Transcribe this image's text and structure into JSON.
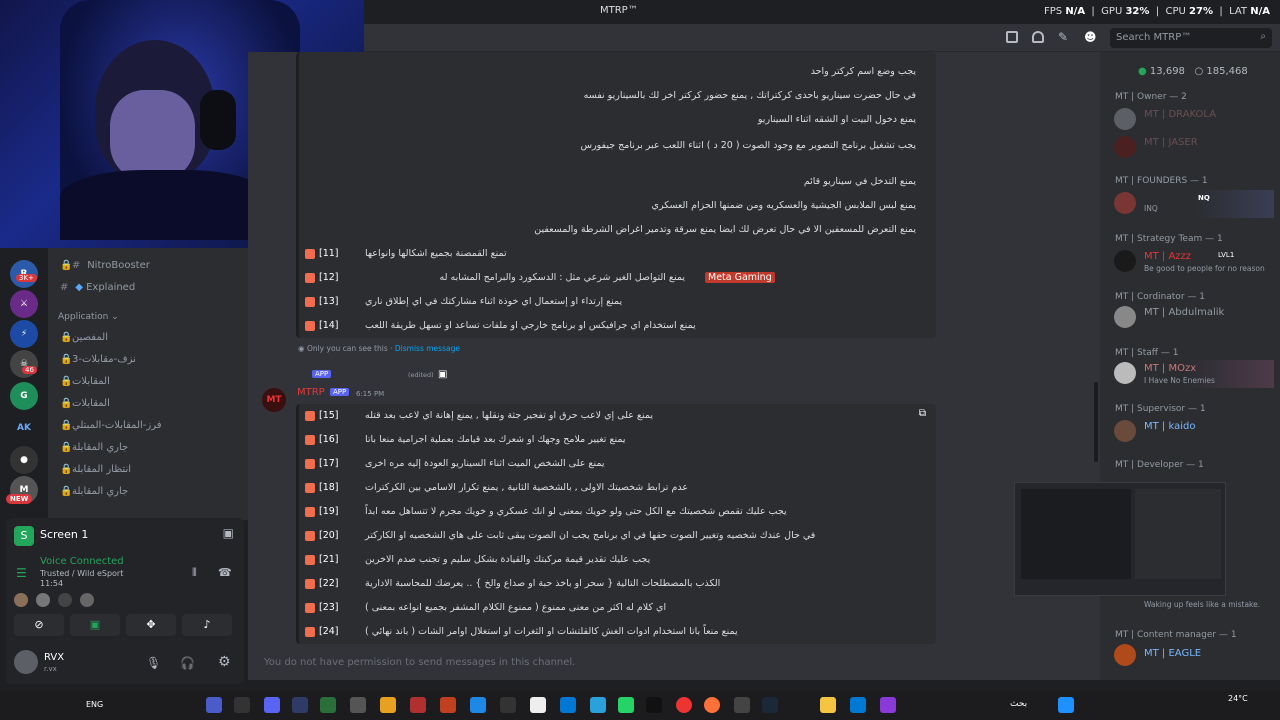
{
  "topbar": {
    "app_title": "MTRP™",
    "fps_label": "FPS",
    "fps_value": "N/A",
    "gpu_label": "GPU",
    "gpu_value": "32%",
    "cpu_label": "CPU",
    "cpu_value": "27%",
    "lat_label": "LAT",
    "lat_value": "N/A"
  },
  "search": {
    "placeholder": "Search MTRP™"
  },
  "rail": {
    "badges": [
      "3K+",
      "46",
      "NEW"
    ]
  },
  "sidebar": {
    "channels": [
      {
        "label": "NitroBooster"
      },
      {
        "label": "Explained"
      }
    ],
    "category": "Application",
    "app_channels": [
      {
        "label": "المفصين"
      },
      {
        "label": "3-نزف-مقابلات"
      },
      {
        "label": "المقابلات"
      },
      {
        "label": "المقابلات"
      },
      {
        "label": "فرز-المقابلات-المبتلي"
      },
      {
        "label": "جاري المقابلة"
      },
      {
        "label": "انتظار المقابلة"
      },
      {
        "label": "جاري المقابلة"
      }
    ]
  },
  "screen_share": {
    "title": "Screen 1",
    "voice_status": "Voice Connected",
    "voice_channel": "Trusted / Wild eSport",
    "time": "11:54"
  },
  "user": {
    "name": "RVX",
    "tag": "r.vx"
  },
  "messages": {
    "first_rules": [
      {
        "num": "",
        "text": "يجب وضع اسم كركتر واحد"
      },
      {
        "num": "",
        "text": "في حال حضرت سيناريو باحدى كركتراتك , يمنع حضور كركتر اخر لك بالسيناريو نفسه"
      },
      {
        "num": "",
        "text": "يمنع دخول البيت او الشقه اثناء السيناريو"
      },
      {
        "num": "",
        "text": "يجب تشغيل برنامج التصوير مع وجود الصوت ( 20 د ) اثناء اللعب عبر برنامج جيفورس"
      },
      {
        "num": "",
        "text": "يمنع التدخل في سيناريو قائم"
      },
      {
        "num": "",
        "text": "يمنع لبس الملابس الجيشية والعسكريه ومن ضمنها الحزام العسكري"
      },
      {
        "num": "",
        "text": "يمنع التعرض للمسعفين الا في حال تعرض لك ايضا يمنع سرقة وتدمير اغراض الشرطة والمسعفين"
      },
      {
        "num": "[11]",
        "text": "تمنع القمصنة بجميع اشكالها وانواعها"
      },
      {
        "num": "[12]",
        "text": "يمنع التواصل الغير شرعي مثل : الدسكورد والبرامج المشابه له"
      },
      {
        "num": "[13]",
        "text": "يمنع إرتداء او إستعمال اي خوذة اثناء مشاركتك في اي إطلاق ناري"
      },
      {
        "num": "[14]",
        "text": "يمنع استخدام اي جرافيكس او برنامج خارجي او ملفات تساعد او تسهل طريقة اللعب"
      }
    ],
    "meta_gaming_tag": "Meta Gaming",
    "ephemeral_note": "Only you can see this",
    "dismiss": "Dismiss message",
    "author": "MTRP",
    "app_badge": "APP",
    "edited": "(edited)",
    "time": "6:15 PM",
    "second_rules": [
      {
        "num": "[15]",
        "text": "يمنع على إي لاعب حرق او تفجير جثة ونقلها , يمنع إهانة اي لاعب بعد قتله"
      },
      {
        "num": "[16]",
        "text": "يمنع تغيير ملامح وجهك او شعرك بعد قيامك بعملية اجرامية منعا باتا"
      },
      {
        "num": "[17]",
        "text": "يمنع على الشخص الميت اثناء السيناريو العودة إليه مره اخرى"
      },
      {
        "num": "[18]",
        "text": "عدم ترابط شخصيتك الاولى , بالشخصية الثانية , يمنع تكرار الاسامي بين الكركترات"
      },
      {
        "num": "[19]",
        "text": "يجب عليك تقمص شخصيتك مع الكل حتى ولو خويك بمعنى لو انك عسكري و خويك مجرم لا تتساهل معه ابداً"
      },
      {
        "num": "[20]",
        "text": "في حال عندك شخصيه وتغيير الصوت حقها في اي برنامج يجب ان الصوت يبقى ثابت على هاي الشخصيه او الكاركتر"
      },
      {
        "num": "[21]",
        "text": "يجب عليك تقدير قيمة مركبتك والقيادة بشكل سليم و تجنب صدم الاخرين"
      },
      {
        "num": "[22]",
        "text": "الكذب بالمصطلحات التالية { سحر او باخذ حبة او صداع والخ } .. يعرضك للمحاسبة الادارية"
      },
      {
        "num": "[23]",
        "text": "اي كلام له اكثر من معنى ممنوع ( ممنوع الكلام المشفر بجميع انواعه بمعنى )"
      },
      {
        "num": "[24]",
        "text": "يمنع منعاً باتا استخدام ادوات الغش كالقلتشات او الثغرات او استغلال اوامر الشات ( باند نهائي )"
      }
    ]
  },
  "input": {
    "placeholder": "You do not have permission to send messages in this channel."
  },
  "members": {
    "online": "13,698",
    "total": "185,468",
    "groups": [
      {
        "label": "MT | Owner — 2"
      },
      {
        "label": "MT | FOUNDERS — 1"
      },
      {
        "label": "MT | Strategy Team — 1"
      },
      {
        "label": "MT | Cordinator — 1"
      },
      {
        "label": "MT | Staff — 1"
      },
      {
        "label": "MT | Supervisor — 1"
      },
      {
        "label": "MT | Developer — 1"
      },
      {
        "label": "MT | Content manager — 1"
      }
    ],
    "list": [
      {
        "name": "MT | DRAKOLA",
        "status": ""
      },
      {
        "name": "MT | JASER",
        "status": ""
      },
      {
        "name": "",
        "status": "INQ"
      },
      {
        "name": "MT | Azzz",
        "status": "Be good to people for no reason"
      },
      {
        "name": "MT | Abdulmalik",
        "status": ""
      },
      {
        "name": "MT | MOzx",
        "status": "I Have No Enemies"
      },
      {
        "name": "MT | kaido",
        "status": ""
      },
      {
        "name": "",
        "status": "Waking up feels like a mistake."
      },
      {
        "name": "MT | EAGLE",
        "status": ""
      }
    ],
    "lvl_badge": "LVL1",
    "nq_badge": "NQ"
  },
  "taskbar": {
    "lang": "ENG",
    "weather_temp": "24°C",
    "search_label": "بحث"
  },
  "colors": {
    "accent": "#5865f2",
    "warn": "#f26c4f",
    "tag_red": "#c0392b",
    "online": "#23a55a"
  }
}
